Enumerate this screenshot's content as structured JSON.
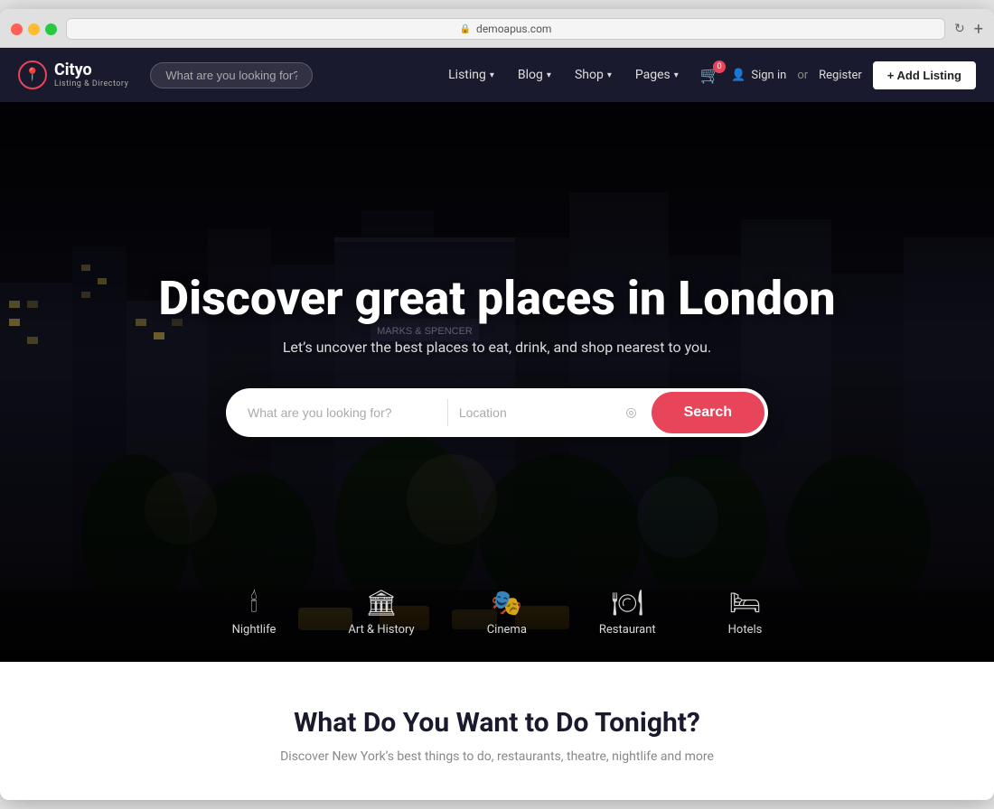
{
  "browser": {
    "url": "demoapus.com",
    "new_tab_label": "+"
  },
  "navbar": {
    "logo_name": "Cityo",
    "logo_subtitle": "Listing & Directory",
    "search_placeholder": "What are you looking for?",
    "menu_items": [
      {
        "label": "Listing",
        "has_dropdown": true
      },
      {
        "label": "Blog",
        "has_dropdown": true
      },
      {
        "label": "Shop",
        "has_dropdown": true
      },
      {
        "label": "Pages",
        "has_dropdown": true
      }
    ],
    "cart_count": "0",
    "signin_label": "Sign in",
    "or_label": "or",
    "register_label": "Register",
    "add_listing_label": "+ Add Listing"
  },
  "hero": {
    "title": "Discover great places in London",
    "subtitle": "Let’s uncover the best places to eat, drink, and shop nearest to you.",
    "search_what_placeholder": "What are you looking for?",
    "search_location_placeholder": "Location",
    "search_button_label": "Search"
  },
  "categories": [
    {
      "id": "nightlife",
      "label": "Nightlife",
      "icon": "🕯"
    },
    {
      "id": "art-history",
      "label": "Art & History",
      "icon": "🏛"
    },
    {
      "id": "cinema",
      "label": "Cinema",
      "icon": "🎭"
    },
    {
      "id": "restaurant",
      "label": "Restaurant",
      "icon": "🍽"
    },
    {
      "id": "hotels",
      "label": "Hotels",
      "icon": "🛏"
    }
  ],
  "bottom": {
    "title": "What Do You Want to Do Tonight?",
    "subtitle": "Discover New York’s best things to do, restaurants, theatre, nightlife and more"
  },
  "colors": {
    "accent": "#e8445a",
    "nav_bg": "#1a1a2e",
    "hero_bg": "#0a0a0a"
  }
}
